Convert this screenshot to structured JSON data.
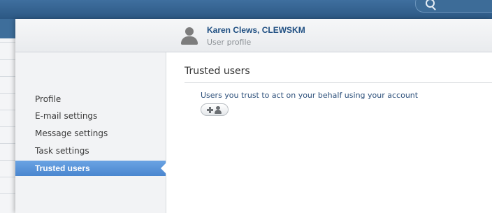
{
  "header": {
    "user_name": "Karen Clews, CLEWSKM",
    "user_subtitle": "User profile"
  },
  "sidebar": {
    "items": [
      {
        "label": "Profile",
        "active": false
      },
      {
        "label": "E-mail settings",
        "active": false
      },
      {
        "label": "Message settings",
        "active": false
      },
      {
        "label": "Task settings",
        "active": false
      },
      {
        "label": "Trusted users",
        "active": true
      }
    ]
  },
  "main": {
    "section_title": "Trusted users",
    "description": "Users you trust to act on your behalf using your account",
    "add_button_icon": "add-user-icon"
  },
  "colors": {
    "topbar": "#2c5884",
    "active_nav": "#4a86cf",
    "user_name": "#1f4f82",
    "description": "#2c4f7a"
  },
  "icons": {
    "search": "search-icon",
    "avatar": "user-avatar-icon"
  }
}
